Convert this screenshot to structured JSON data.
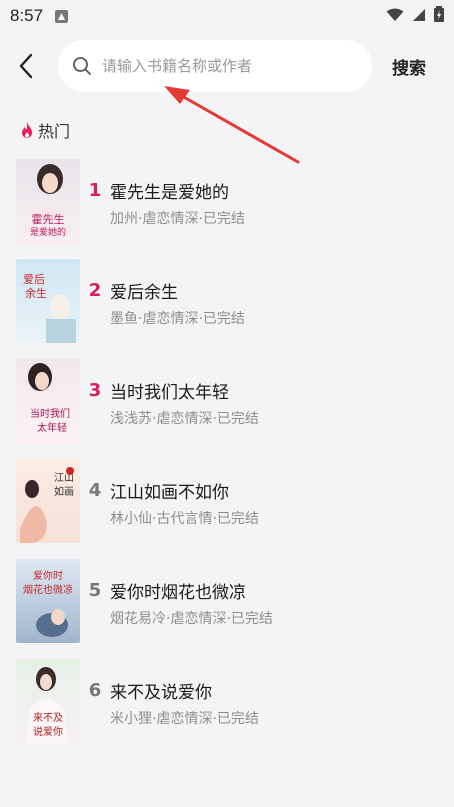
{
  "status_bar": {
    "time": "8:57"
  },
  "header": {
    "search_placeholder": "请输入书籍名称或作者",
    "search_button_label": "搜索"
  },
  "section": {
    "title": "热门"
  },
  "books": [
    {
      "rank": "1",
      "title": "霍先生是爱她的",
      "meta": "加州·虐恋情深·已完结",
      "rank_color": "#d81b60",
      "cover_text": "霍先生是爱她的"
    },
    {
      "rank": "2",
      "title": "爱后余生",
      "meta": "墨鱼·虐恋情深·已完结",
      "rank_color": "#d81b60",
      "cover_text": "爱后余生"
    },
    {
      "rank": "3",
      "title": "当时我们太年轻",
      "meta": "浅浅苏·虐恋情深·已完结",
      "rank_color": "#d81b60",
      "cover_text": "当时我们太年轻"
    },
    {
      "rank": "4",
      "title": "江山如画不如你",
      "meta": "林小仙·古代言情·已完结",
      "rank_color": "#777777",
      "cover_text": "江山如画"
    },
    {
      "rank": "5",
      "title": "爱你时烟花也微凉",
      "meta": "烟花易冷·虐恋情深·已完结",
      "rank_color": "#777777",
      "cover_text": "爱你时烟花也微凉"
    },
    {
      "rank": "6",
      "title": "来不及说爱你",
      "meta": "米小狸·虐恋情深·已完结",
      "rank_color": "#777777",
      "cover_text": "来不及说爱你"
    }
  ],
  "colors": {
    "accent": "#d81b60",
    "annotation_arrow": "#e53935"
  }
}
